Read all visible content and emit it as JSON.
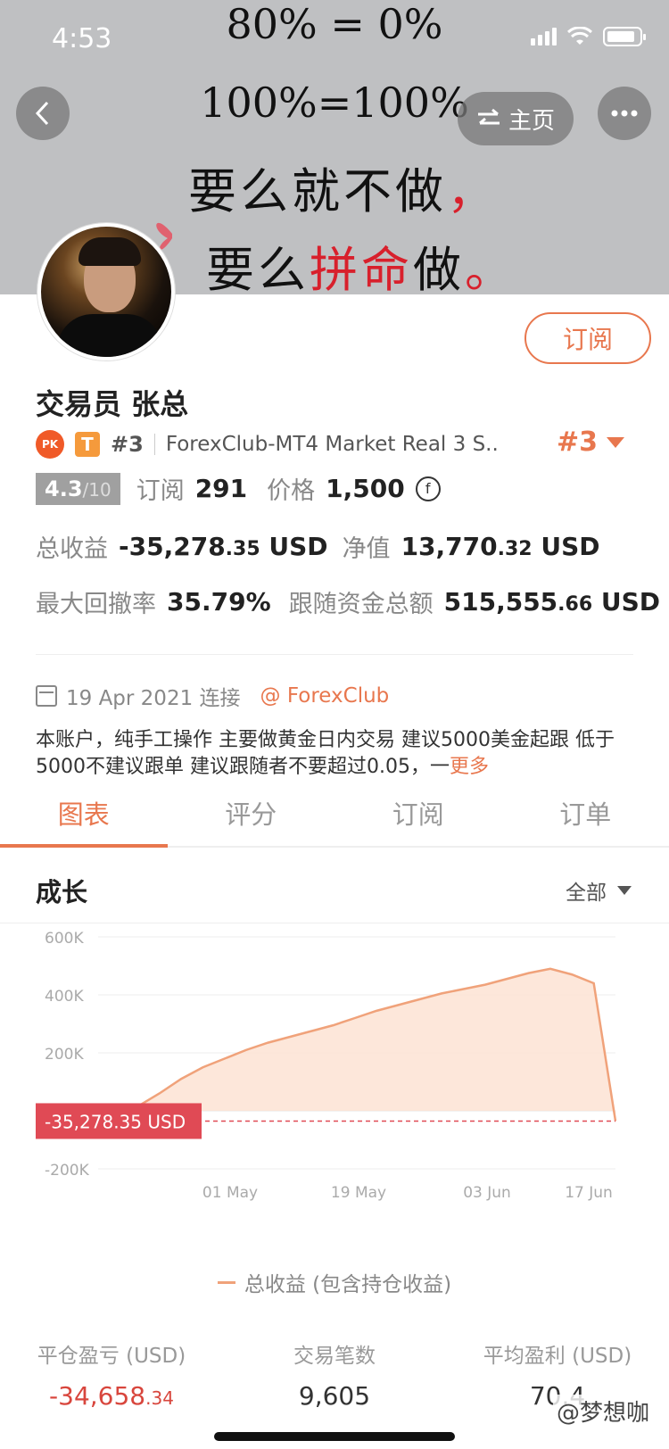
{
  "status": {
    "time": "4:53"
  },
  "banner": {
    "line1": "80% = 0%",
    "line2": "100%=100%",
    "line3_a": "要么就不做",
    "line3_b": "，",
    "line4_a": "要么",
    "line4_b": "拼命",
    "line4_c": "做",
    "line4_d": "。"
  },
  "nav": {
    "back_icon": "chevron-left-icon",
    "home_label": "主页",
    "home_icon": "swap-arrows-icon",
    "more_icon": "more-dots-icon"
  },
  "profile": {
    "name": "交易员  张总",
    "subscribe_label": "订阅",
    "pk_badge": "PK",
    "t_badge": "T",
    "rank_small": "#3",
    "server": "ForexClub-MT4 Market Real 3 S...",
    "rank_big": "#3"
  },
  "stats": {
    "score": "4.3",
    "score_max": "/10",
    "subs_label": "订阅",
    "subs_value": "291",
    "price_label": "价格",
    "price_value": "1,500",
    "coin_symbol": "f",
    "profit_label": "总收益",
    "profit_main": "-35,278",
    "profit_cents": ".35",
    "profit_unit": " USD",
    "equity_label": "净值",
    "equity_main": "13,770",
    "equity_cents": ".32",
    "equity_unit": " USD",
    "drawdown_label": "最大回撤率",
    "drawdown_value": "35.79%",
    "follow_label": "跟随资金总额",
    "follow_main": "515,555",
    "follow_cents": ".66",
    "follow_unit": " USD"
  },
  "info": {
    "date": "19 Apr 2021 连接",
    "broker": "@ ForexClub",
    "description": "本账户，纯手工操作 主要做黄金日内交易   建议5000美金起跟  低于5000不建议跟单 建议跟随者不要超过0.05，一",
    "more": "更多"
  },
  "tabs": [
    "图表",
    "评分",
    "订阅",
    "订单"
  ],
  "section": {
    "title": "成长",
    "filter": "全部"
  },
  "chart_data": {
    "type": "area",
    "y_ticks": [
      "600K",
      "400K",
      "200K",
      "-200K"
    ],
    "x_ticks": [
      "01 May",
      "19 May",
      "03 Jun",
      "17 Jun"
    ],
    "ylim": [
      -200000,
      600000
    ],
    "current_label": "-35,278.35 USD",
    "current_value": -35278.35,
    "series": [
      {
        "name": "总收益 (包含持仓收益)",
        "points": [
          [
            "19 Apr",
            0
          ],
          [
            "22 Apr",
            15000
          ],
          [
            "25 Apr",
            60000
          ],
          [
            "28 Apr",
            110000
          ],
          [
            "01 May",
            150000
          ],
          [
            "04 May",
            180000
          ],
          [
            "07 May",
            210000
          ],
          [
            "10 May",
            235000
          ],
          [
            "13 May",
            255000
          ],
          [
            "16 May",
            275000
          ],
          [
            "19 May",
            295000
          ],
          [
            "22 May",
            320000
          ],
          [
            "25 May",
            345000
          ],
          [
            "28 May",
            365000
          ],
          [
            "31 May",
            385000
          ],
          [
            "03 Jun",
            405000
          ],
          [
            "06 Jun",
            420000
          ],
          [
            "09 Jun",
            435000
          ],
          [
            "12 Jun",
            455000
          ],
          [
            "14 Jun",
            475000
          ],
          [
            "16 Jun",
            490000
          ],
          [
            "17 Jun",
            470000
          ],
          [
            "18 Jun",
            440000
          ],
          [
            "19 Jun",
            -35278
          ]
        ]
      }
    ],
    "color": "#f0a27a"
  },
  "legend": "总收益 (包含持仓收益)",
  "summary": [
    {
      "label": "平仓盈亏 (USD)",
      "main": "-34,658",
      "cents": ".34",
      "negative": true
    },
    {
      "label": "交易笔数",
      "main": "9,605",
      "cents": "",
      "negative": false
    },
    {
      "label": "平均盈利 (USD)",
      "main": "70.4",
      "cents": "",
      "negative": false
    }
  ],
  "watermark": "@梦想咖"
}
